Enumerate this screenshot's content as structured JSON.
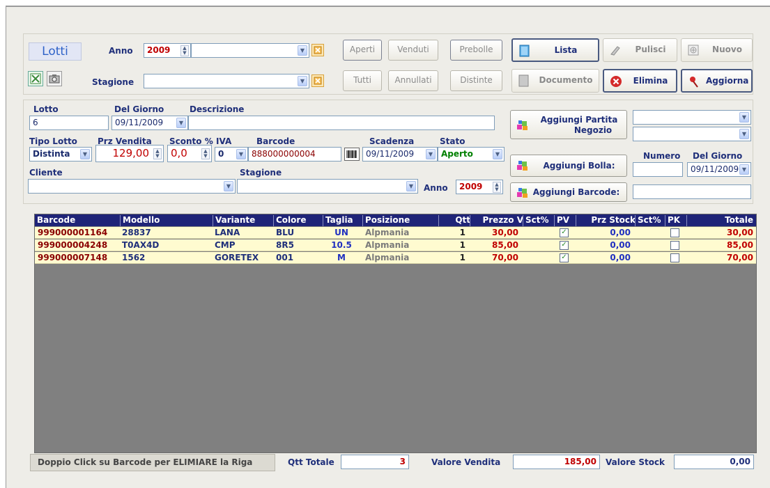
{
  "header": {
    "title": "Lotti",
    "anno_label": "Anno",
    "anno_value": "2009",
    "stagione_label": "Stagione"
  },
  "filters": {
    "aperti": "Aperti",
    "venduti": "Venduti",
    "prebolle": "Prebolle",
    "tutti": "Tutti",
    "annullati": "Annullati",
    "distinte": "Distinte"
  },
  "toolbar": {
    "lista": "Lista",
    "pulisci": "Pulisci",
    "nuovo": "Nuovo",
    "documento": "Documento",
    "elimina": "Elimina",
    "aggiorna": "Aggiorna"
  },
  "form": {
    "lotto_label": "Lotto",
    "lotto_value": "6",
    "delgiorno_label": "Del Giorno",
    "delgiorno_value": "09/11/2009",
    "descrizione_label": "Descrizione",
    "descrizione_value": "",
    "tipolotto_label": "Tipo Lotto",
    "tipolotto_value": "Distinta",
    "przvendita_label": "Prz Vendita",
    "przvendita_value": "129,00",
    "sconto_label": "Sconto %",
    "sconto_value": "0,0",
    "iva_label": "IVA",
    "iva_value": "0",
    "barcode_label": "Barcode",
    "barcode_value": "888000000004",
    "scadenza_label": "Scadenza",
    "scadenza_value": "09/11/2009",
    "stato_label": "Stato",
    "stato_value": "Aperto",
    "cliente_label": "Cliente",
    "cliente_value": "",
    "stagione_label": "Stagione",
    "stagione_value": "",
    "anno_label": "Anno",
    "anno_value": "2009"
  },
  "right_panel": {
    "aggiungi_partita": "Aggiungi Partita\nNegozio",
    "aggiungi_partita_l1": "Aggiungi Partita",
    "aggiungi_partita_l2": "Negozio",
    "aggiungi_bolla": "Aggiungi Bolla:",
    "aggiungi_barcode": "Aggiungi Barcode:",
    "numero_label": "Numero",
    "delgiorno_label": "Del Giorno",
    "delgiorno_value": "09/11/2009"
  },
  "table": {
    "columns": [
      "Barcode",
      "Modello",
      "Variante",
      "Colore",
      "Taglia",
      "Posizione",
      "Qtt",
      "Prezzo V",
      "Sct%",
      "PV",
      "Prz Stock",
      "Sct%",
      "PK",
      "Totale"
    ],
    "rows": [
      {
        "barcode": "999000001164",
        "modello": "28837",
        "variante": "LANA",
        "colore": "BLU",
        "taglia": "UN",
        "posizione": "Alpmania",
        "qtt": "1",
        "prezzo": "30,00",
        "sct": "",
        "pv": true,
        "przstock": "0,00",
        "sct2": "",
        "pk": false,
        "totale": "30,00"
      },
      {
        "barcode": "999000004248",
        "modello": "T0AX4D",
        "variante": "CMP",
        "colore": "8R5",
        "taglia": "10.5",
        "posizione": "Alpmania",
        "qtt": "1",
        "prezzo": "85,00",
        "sct": "",
        "pv": true,
        "przstock": "0,00",
        "sct2": "",
        "pk": false,
        "totale": "85,00"
      },
      {
        "barcode": "999000007148",
        "modello": "1562",
        "variante": "GORETEX",
        "colore": "001",
        "taglia": "M",
        "posizione": "Alpmania",
        "qtt": "1",
        "prezzo": "70,00",
        "sct": "",
        "pv": true,
        "przstock": "0,00",
        "sct2": "",
        "pk": false,
        "totale": "70,00"
      }
    ]
  },
  "footer": {
    "hint": "Doppio Click su Barcode per ELIMIARE la Riga",
    "qtt_label": "Qtt Totale",
    "qtt_value": "3",
    "valore_vendita_label": "Valore Vendita",
    "valore_vendita_value": "185,00",
    "valore_stock_label": "Valore Stock",
    "valore_stock_value": "0,00"
  },
  "icons": {
    "excel": "excel-icon",
    "camera": "camera-icon",
    "clear": "clear-icon",
    "list": "list-icon",
    "broom": "broom-icon",
    "new": "new-icon",
    "document": "document-icon",
    "delete": "delete-icon",
    "pin": "pin-icon",
    "barcode": "barcode-icon",
    "boxes": "boxes-icon"
  },
  "colors": {
    "accent": "#1f2478",
    "value_red": "#c00000",
    "label_blue": "#1f2f7a",
    "row_bg": "#fffbd0",
    "grid_bg": "#808080",
    "status_green": "#008000"
  }
}
